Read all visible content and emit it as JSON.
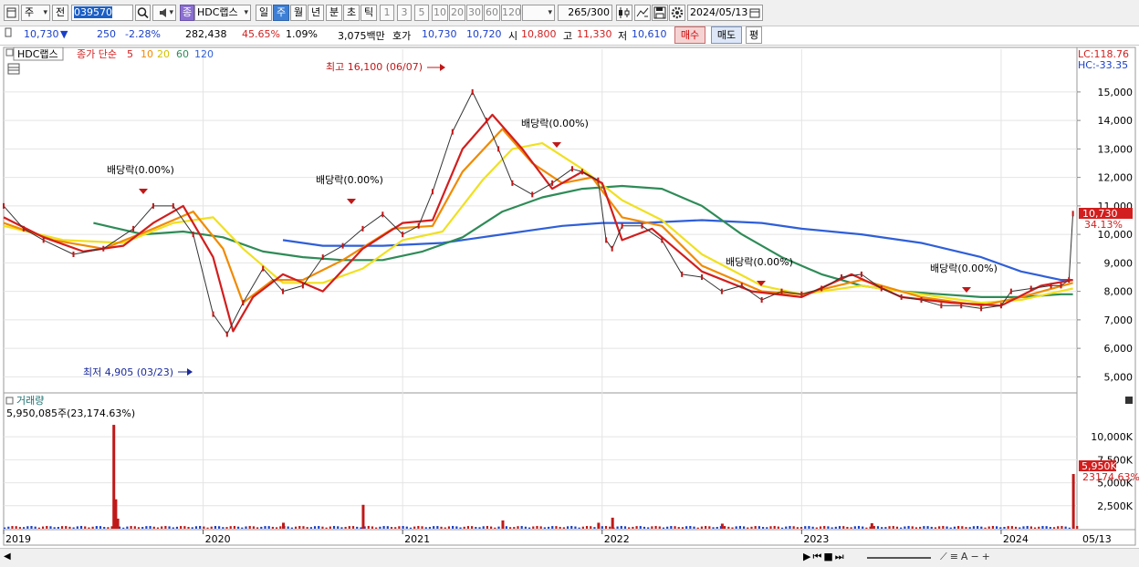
{
  "toolbar": {
    "period_label": "주",
    "prev_label": "전",
    "code": "039570",
    "stock_name": "HDC랩스",
    "stock_tag": "종",
    "periods": [
      "일",
      "주",
      "월",
      "년",
      "분",
      "초",
      "틱"
    ],
    "selected_period": "주",
    "intervals": [
      "1",
      "3",
      "5",
      "10",
      "20",
      "30",
      "60",
      "120"
    ],
    "count": "265",
    "count_total": "/300",
    "date": "2024/05/13"
  },
  "quote": {
    "price": "10,730",
    "change_arrow": "▼",
    "change": "250",
    "change_pct": "-2.28%",
    "volume": "282,438",
    "turnover_pct": "45.65%",
    "vol_ratio": "1.09%",
    "amount": "3,075백만",
    "hoga_label": "호가",
    "ask": "10,730",
    "bid": "10,720",
    "open_label": "시",
    "open": "10,800",
    "high_label": "고",
    "high": "11,330",
    "low_label": "저",
    "low": "10,610",
    "buy_label": "매수",
    "sell_label": "매도",
    "eval_label": "평"
  },
  "legend": {
    "name": "HDC랩스",
    "title": "종가 단순",
    "ma": [
      {
        "label": "5",
        "color": "#d21e1e"
      },
      {
        "label": "10",
        "color": "#f08a00"
      },
      {
        "label": "20",
        "color": "#e8d800"
      },
      {
        "label": "60",
        "color": "#2e8b57"
      },
      {
        "label": "120",
        "color": "#2f5fd8"
      }
    ]
  },
  "annotations": {
    "high": "최고 16,100 (06/07)",
    "low": "최저 4,905 (03/23)",
    "dividend": "배당락(0.00%)"
  },
  "right_scale": {
    "lc": "LC:118.76",
    "hc": "HC:-33.35",
    "price_tag": "10,730",
    "pct_tag": "34.13%",
    "vol_tag": "5,950K",
    "vol_pct_tag": "23174.63%"
  },
  "volume_panel": {
    "title": "거래량",
    "value": "5,950,085주(23,174.63%)"
  },
  "x_axis": {
    "labels": [
      "2019",
      "2020",
      "2021",
      "2022",
      "2023",
      "2024"
    ],
    "end_label": "05/13"
  },
  "chart_data": {
    "type": "line",
    "title": "HDC랩스 종가 단순",
    "x_unit": "year",
    "y_unit": "KRW",
    "ylim": [
      4500,
      16500
    ],
    "y_ticks": [
      5000,
      6000,
      7000,
      8000,
      9000,
      10000,
      11000,
      12000,
      13000,
      14000,
      15000
    ],
    "volume_ylim": [
      0,
      12000
    ],
    "volume_ticks": [
      2500,
      5000,
      7500,
      10000
    ],
    "price": {
      "x": [
        2019.0,
        2019.1,
        2019.2,
        2019.35,
        2019.5,
        2019.65,
        2019.75,
        2019.85,
        2019.95,
        2020.05,
        2020.12,
        2020.2,
        2020.3,
        2020.4,
        2020.5,
        2020.6,
        2020.7,
        2020.8,
        2020.9,
        2021.0,
        2021.08,
        2021.15,
        2021.25,
        2021.35,
        2021.42,
        2021.48,
        2021.55,
        2021.65,
        2021.75,
        2021.85,
        2021.9,
        2021.98,
        2022.02,
        2022.05,
        2022.1,
        2022.2,
        2022.3,
        2022.4,
        2022.5,
        2022.6,
        2022.7,
        2022.8,
        2022.9,
        2023.0,
        2023.1,
        2023.2,
        2023.3,
        2023.4,
        2023.5,
        2023.6,
        2023.7,
        2023.8,
        2023.9,
        2024.0,
        2024.05,
        2024.15,
        2024.25,
        2024.3,
        2024.34,
        2024.36
      ],
      "y": [
        11000,
        10200,
        9800,
        9300,
        9500,
        10200,
        11000,
        11000,
        10000,
        7200,
        6500,
        7600,
        8800,
        8000,
        8200,
        9200,
        9600,
        10200,
        10700,
        10000,
        10300,
        11500,
        13600,
        15000,
        14000,
        13000,
        11800,
        11400,
        11800,
        12300,
        12200,
        11900,
        9800,
        9500,
        10300,
        10300,
        9800,
        8600,
        8500,
        8000,
        8200,
        7700,
        8000,
        7900,
        8100,
        8500,
        8600,
        8100,
        7800,
        7700,
        7500,
        7500,
        7400,
        7500,
        8000,
        8100,
        8200,
        8200,
        8400,
        10730
      ]
    },
    "ma5": {
      "x": [
        2019.0,
        2019.2,
        2019.4,
        2019.6,
        2019.75,
        2019.9,
        2020.05,
        2020.15,
        2020.25,
        2020.4,
        2020.6,
        2020.8,
        2021.0,
        2021.15,
        2021.3,
        2021.45,
        2021.6,
        2021.75,
        2021.9,
        2022.0,
        2022.1,
        2022.25,
        2022.5,
        2022.75,
        2023.0,
        2023.25,
        2023.5,
        2023.75,
        2024.0,
        2024.2,
        2024.36
      ],
      "y": [
        10600,
        9900,
        9400,
        9600,
        10400,
        11000,
        9200,
        6600,
        7800,
        8600,
        8000,
        9500,
        10400,
        10500,
        13000,
        14200,
        13000,
        11600,
        12200,
        11800,
        9800,
        10200,
        8700,
        8000,
        7800,
        8600,
        7800,
        7600,
        7500,
        8200,
        8400
      ]
    },
    "ma10": {
      "x": [
        2019.0,
        2019.25,
        2019.5,
        2019.75,
        2019.95,
        2020.1,
        2020.2,
        2020.35,
        2020.5,
        2020.7,
        2020.95,
        2021.15,
        2021.3,
        2021.5,
        2021.65,
        2021.8,
        2021.95,
        2022.1,
        2022.3,
        2022.5,
        2022.8,
        2023.0,
        2023.3,
        2023.6,
        2023.9,
        2024.1,
        2024.36
      ],
      "y": [
        10400,
        9800,
        9500,
        10200,
        10800,
        9500,
        7600,
        8400,
        8400,
        9100,
        10200,
        10300,
        12200,
        13700,
        12500,
        11800,
        12000,
        10600,
        10300,
        8900,
        8000,
        7900,
        8400,
        7800,
        7500,
        7800,
        8300
      ]
    },
    "ma20": {
      "x": [
        2019.0,
        2019.3,
        2019.6,
        2019.85,
        2020.05,
        2020.2,
        2020.4,
        2020.6,
        2020.8,
        2021.0,
        2021.2,
        2021.4,
        2021.55,
        2021.7,
        2021.9,
        2022.1,
        2022.3,
        2022.5,
        2022.8,
        2023.0,
        2023.3,
        2023.6,
        2023.9,
        2024.1,
        2024.36
      ],
      "y": [
        10300,
        9800,
        9700,
        10400,
        10600,
        9500,
        8300,
        8300,
        8800,
        9800,
        10100,
        11900,
        13000,
        13200,
        12300,
        11200,
        10500,
        9300,
        8200,
        7900,
        8200,
        7900,
        7600,
        7700,
        8100
      ]
    },
    "ma60": {
      "x": [
        2019.45,
        2019.7,
        2019.9,
        2020.1,
        2020.3,
        2020.5,
        2020.7,
        2020.9,
        2021.1,
        2021.3,
        2021.5,
        2021.7,
        2021.9,
        2022.1,
        2022.3,
        2022.5,
        2022.7,
        2022.9,
        2023.1,
        2023.3,
        2023.5,
        2023.7,
        2023.9,
        2024.1,
        2024.3,
        2024.36
      ],
      "y": [
        10400,
        10000,
        10100,
        9900,
        9400,
        9200,
        9100,
        9100,
        9400,
        9900,
        10800,
        11300,
        11600,
        11700,
        11600,
        11000,
        10000,
        9200,
        8600,
        8200,
        8000,
        7900,
        7800,
        7800,
        7900,
        7900
      ]
    },
    "ma120": {
      "x": [
        2020.4,
        2020.6,
        2020.9,
        2021.2,
        2021.5,
        2021.8,
        2022.0,
        2022.2,
        2022.5,
        2022.8,
        2023.0,
        2023.3,
        2023.6,
        2023.9,
        2024.1,
        2024.3,
        2024.36
      ],
      "y": [
        9800,
        9600,
        9600,
        9700,
        10000,
        10300,
        10400,
        10400,
        10500,
        10400,
        10200,
        10000,
        9700,
        9200,
        8700,
        8400,
        8400
      ]
    },
    "volume": {
      "x": [
        2019.55,
        2019.56,
        2019.57,
        2020.4,
        2020.8,
        2021.5,
        2021.98,
        2022.05,
        2022.6,
        2023.35,
        2024.36
      ],
      "y": [
        11300,
        3200,
        1100,
        650,
        2600,
        900,
        650,
        1200,
        550,
        600,
        5950
      ]
    }
  }
}
